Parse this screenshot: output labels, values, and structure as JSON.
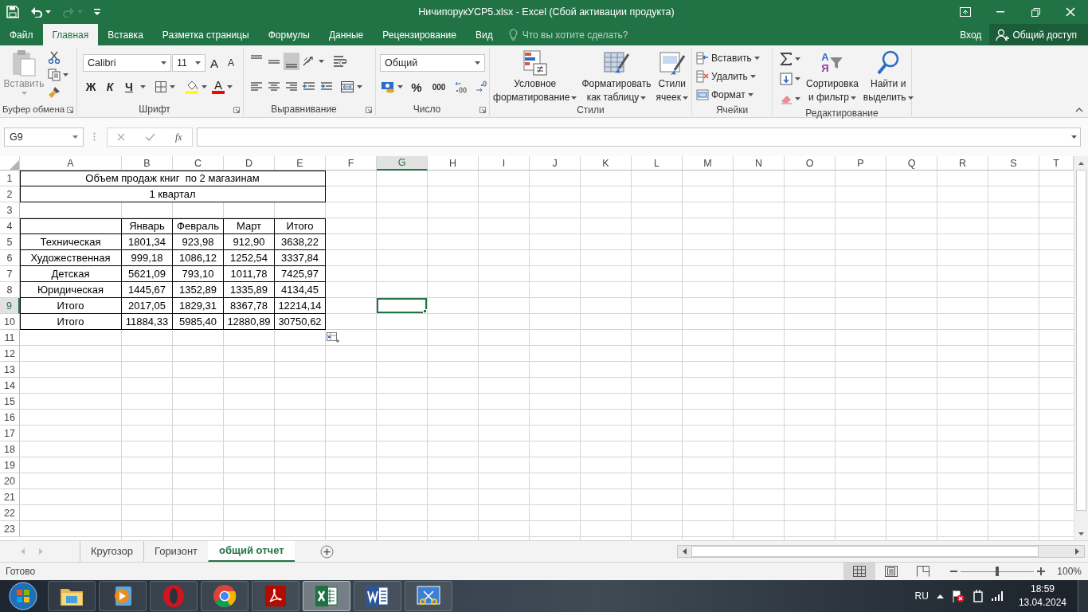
{
  "window": {
    "title": "НичипорукУСР5.xlsx - Excel (Сбой активации продукта)"
  },
  "quick_access": [
    {
      "kind": "save",
      "disabled": false
    },
    {
      "kind": "undo",
      "disabled": false
    },
    {
      "kind": "redo",
      "disabled": true
    },
    {
      "kind": "customize",
      "disabled": false
    }
  ],
  "ribbon_tabs": [
    {
      "label": "Файл",
      "selected": false
    },
    {
      "label": "Главная",
      "selected": true
    },
    {
      "label": "Вставка",
      "selected": false
    },
    {
      "label": "Разметка страницы",
      "selected": false
    },
    {
      "label": "Формулы",
      "selected": false
    },
    {
      "label": "Данные",
      "selected": false
    },
    {
      "label": "Рецензирование",
      "selected": false
    },
    {
      "label": "Вид",
      "selected": false
    }
  ],
  "tell_me": {
    "placeholder": "Что вы хотите сделать?"
  },
  "account": {
    "sign_in": "Вход",
    "share": "Общий доступ"
  },
  "ribbon": {
    "clipboard": {
      "paste": "Вставить",
      "label": "Буфер обмена"
    },
    "font": {
      "font_name": "Calibri",
      "font_size": "11",
      "grow": "A",
      "shrink": "A",
      "bold": "Ж",
      "italic": "К",
      "underline": "Ч",
      "font_color": "A",
      "label": "Шрифт"
    },
    "alignment": {
      "label": "Выравнивание"
    },
    "number": {
      "format": "Общий",
      "percent": "%",
      "thousands": "000",
      "label": "Число"
    },
    "styles": {
      "buttons": [
        {
          "lines": [
            "Условное",
            "форматирование"
          ]
        },
        {
          "lines": [
            "Форматировать",
            "как таблицу"
          ]
        },
        {
          "lines": [
            "Стили",
            "ячеек"
          ]
        }
      ],
      "label": "Стили"
    },
    "cells": {
      "buttons": [
        "Вставить",
        "Удалить",
        "Формат"
      ],
      "label": "Ячейки"
    },
    "editing": {
      "buttons": [
        {
          "lines": [
            "Сортировка",
            "и фильтр"
          ]
        },
        {
          "lines": [
            "Найти и",
            "выделить"
          ]
        }
      ],
      "sort_letters": [
        "А",
        "Я"
      ],
      "label": "Редактирование"
    }
  },
  "formula_bar": {
    "name_box": "G9",
    "fx": "fx"
  },
  "sheet": {
    "columns": [
      {
        "label": "A",
        "selected": false
      },
      {
        "label": "B",
        "selected": false
      },
      {
        "label": "C",
        "selected": false
      },
      {
        "label": "D",
        "selected": false
      },
      {
        "label": "E",
        "selected": false
      },
      {
        "label": "F",
        "selected": false
      },
      {
        "label": "G",
        "selected": true
      },
      {
        "label": "H",
        "selected": false
      },
      {
        "label": "I",
        "selected": false
      },
      {
        "label": "J",
        "selected": false
      },
      {
        "label": "K",
        "selected": false
      },
      {
        "label": "L",
        "selected": false
      },
      {
        "label": "M",
        "selected": false
      },
      {
        "label": "N",
        "selected": false
      },
      {
        "label": "O",
        "selected": false
      },
      {
        "label": "P",
        "selected": false
      },
      {
        "label": "Q",
        "selected": false
      },
      {
        "label": "R",
        "selected": false
      },
      {
        "label": "S",
        "selected": false
      },
      {
        "label": "T",
        "selected": false
      }
    ],
    "rows": [
      {
        "label": "1",
        "selected": false
      },
      {
        "label": "2",
        "selected": false
      },
      {
        "label": "3",
        "selected": false
      },
      {
        "label": "4",
        "selected": false
      },
      {
        "label": "5",
        "selected": false
      },
      {
        "label": "6",
        "selected": false
      },
      {
        "label": "7",
        "selected": false
      },
      {
        "label": "8",
        "selected": false
      },
      {
        "label": "9",
        "selected": true
      },
      {
        "label": "10",
        "selected": false
      },
      {
        "label": "11",
        "selected": false
      },
      {
        "label": "12",
        "selected": false
      },
      {
        "label": "13",
        "selected": false
      },
      {
        "label": "14",
        "selected": false
      },
      {
        "label": "15",
        "selected": false
      },
      {
        "label": "16",
        "selected": false
      },
      {
        "label": "17",
        "selected": false
      },
      {
        "label": "18",
        "selected": false
      },
      {
        "label": "19",
        "selected": false
      },
      {
        "label": "20",
        "selected": false
      },
      {
        "label": "21",
        "selected": false
      },
      {
        "label": "22",
        "selected": false
      },
      {
        "label": "23",
        "selected": false
      }
    ],
    "table": {
      "title": "Объем продаж книг  по 2 магазинам",
      "subtitle": "1 квартал",
      "header": [
        "Январь",
        "Февраль",
        "Март",
        "Итого"
      ],
      "rows": [
        {
          "label": "Техническая",
          "values": [
            "1801,34",
            "923,98",
            "912,90",
            "3638,22"
          ]
        },
        {
          "label": "Художественная",
          "values": [
            "999,18",
            "1086,12",
            "1252,54",
            "3337,84"
          ]
        },
        {
          "label": "Детская",
          "values": [
            "5621,09",
            "793,10",
            "1011,78",
            "7425,97"
          ]
        },
        {
          "label": "Юридическая",
          "values": [
            "1445,67",
            "1352,89",
            "1335,89",
            "4134,45"
          ]
        },
        {
          "label": "Итого",
          "values": [
            "2017,05",
            "1829,31",
            "8367,78",
            "12214,14"
          ]
        },
        {
          "label": "Итого",
          "values": [
            "11884,33",
            "5985,40",
            "12880,89",
            "30750,62"
          ]
        }
      ]
    }
  },
  "sheet_tabs": [
    {
      "label": "Кругозор",
      "selected": false
    },
    {
      "label": "Горизонт",
      "selected": false
    },
    {
      "label": "общий отчет",
      "selected": true
    }
  ],
  "status_bar": {
    "status": "Готово",
    "views": [
      {
        "kind": "normal",
        "selected": true
      },
      {
        "kind": "page_layout",
        "selected": false
      },
      {
        "kind": "page_break",
        "selected": false
      }
    ],
    "zoom": {
      "level": 0.5,
      "reading": "100%"
    }
  },
  "taskbar": {
    "apps": [
      {
        "kind": "explorer",
        "active": false
      },
      {
        "kind": "media",
        "active": false
      },
      {
        "kind": "opera",
        "active": false
      },
      {
        "kind": "chrome",
        "active": false
      },
      {
        "kind": "pdf",
        "active": false
      },
      {
        "kind": "excel",
        "active": true
      },
      {
        "kind": "word",
        "active": false
      },
      {
        "kind": "snip",
        "active": false
      }
    ],
    "language": "RU",
    "time": "18:59",
    "date": "13.04.2024"
  }
}
